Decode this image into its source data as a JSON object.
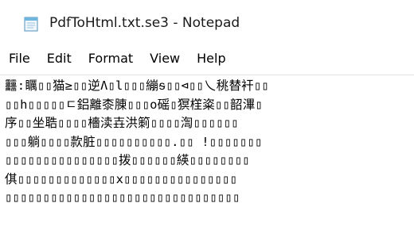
{
  "window": {
    "title": "PdfToHtml.txt.se3 - Notepad",
    "icon": "notepad-icon"
  },
  "menu": {
    "items": [
      "File",
      "Edit",
      "Format",
      "View",
      "Help"
    ]
  },
  "editor": {
    "lines": [
      "䨻:矋▯▯猫≥▯▯逆Ʌ▯l▯▯▯繃ᵴ▯▯⊲▯▯乀䄻替衦▯▯",
      "▯▯h▯▯▯▯▯ㄷ鋁離桼腖▯▯▯o磘▯猽樦粢▯▯韶滭▯",
      "序▯▯坐聕▯▯▯▯檣渎壵洪箣▯▯▯▯渹▯▯▯▯▯▯",
      "▯▯▯躺▯▯▯▯款脏▯▯▯▯▯▯▯▯▯▯.▯▯ !▯▯▯▯▯▯▯",
      "▯▯▯▯▯▯▯▯▯▯▯▯▯▯▯拨▯▯▯▯▯▯緓▯▯▯▯▯▯▯▯",
      "倛▯▯▯▯▯▯▯▯▯▯▯▯▯x▯▯▯▯▯▯▯▯▯▯▯▯▯▯▯",
      "▯▯▯▯▯▯▯▯▯▯▯▯▯▯▯▯▯▯▯▯▯▯▯▯▯▯▯▯▯▯▯"
    ]
  }
}
